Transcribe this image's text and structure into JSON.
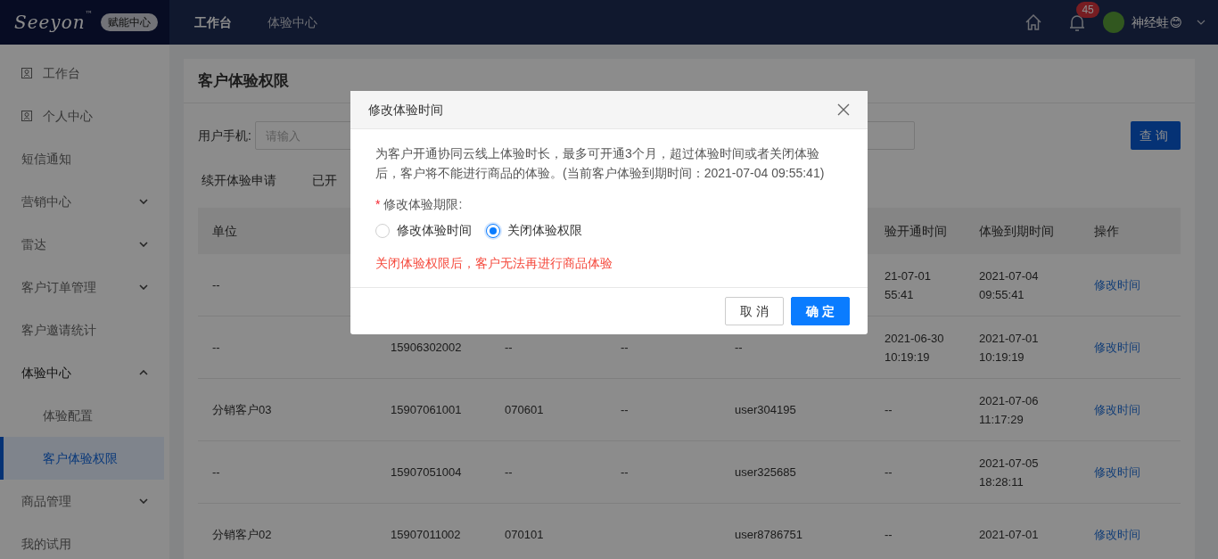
{
  "topbar": {
    "logo": "Seeyon",
    "logo_mark": "™",
    "badge": "赋能中心",
    "nav": [
      {
        "label": "工作台",
        "selected": true
      },
      {
        "label": "体验中心",
        "selected": false
      }
    ],
    "notification_count": "45",
    "user_name": "神经蛙😊"
  },
  "sidebar": {
    "items": [
      {
        "label": "工作台",
        "kind": "icon"
      },
      {
        "label": "个人中心",
        "kind": "icon"
      },
      {
        "label": "短信通知",
        "kind": "plain"
      },
      {
        "label": "营销中心",
        "kind": "group",
        "expanded": false
      },
      {
        "label": "雷达",
        "kind": "group",
        "expanded": false
      },
      {
        "label": "客户订单管理",
        "kind": "group",
        "expanded": false
      },
      {
        "label": "客户邀请统计",
        "kind": "plain"
      },
      {
        "label": "体验中心",
        "kind": "group",
        "expanded": true,
        "children": [
          {
            "label": "体验配置",
            "selected": false
          },
          {
            "label": "客户体验权限",
            "selected": true
          }
        ]
      },
      {
        "label": "商品管理",
        "kind": "group",
        "expanded": false
      },
      {
        "label": "我的试用",
        "kind": "plain"
      }
    ]
  },
  "page": {
    "title": "客户体验权限",
    "filter_label": "用户手机:",
    "filter_placeholder": "请输入",
    "search_button": "查询",
    "tabs": [
      {
        "label": "续开体验申请",
        "selected": false
      },
      {
        "label": "已开",
        "selected": false
      }
    ],
    "table": {
      "columns": [
        "单位",
        null,
        null,
        null,
        null,
        "验开通时间",
        "体验到期时间",
        "操作"
      ],
      "rows": [
        {
          "cells": [
            "--",
            null,
            null,
            null,
            null,
            "21-07-01\n55:41",
            "2021-07-04\n09:55:41"
          ],
          "action": "修改时间"
        },
        {
          "cells": [
            "--",
            "15906302002",
            "--",
            "--",
            "--",
            "2021-06-30\n10:19:19",
            "2021-07-01\n10:19:19"
          ],
          "action": "修改时间"
        },
        {
          "cells": [
            "分销客户03",
            "15907061001",
            "070601",
            "--",
            "user304195",
            "--",
            "2021-07-06\n11:17:29"
          ],
          "action": "修改时间"
        },
        {
          "cells": [
            "--",
            "15907051004",
            "--",
            "--",
            "user325685",
            "--",
            "2021-07-05\n18:28:11"
          ],
          "action": "修改时间"
        },
        {
          "cells": [
            "分销客户02",
            "15907011002",
            "070101",
            null,
            "user8786751",
            "--",
            "2021-07-01"
          ],
          "action": "修改时间"
        }
      ]
    }
  },
  "dialog": {
    "title": "修改体验时间",
    "description": "为客户开通协同云线上体验时长，最多可开通3个月，超过体验时间或者关闭体验后，客户将不能进行商品的体验。(当前客户体验到期时间：2021-07-04 09:55:41)",
    "required_mark": "*",
    "field_label": "修改体验期限:",
    "options": [
      {
        "label": "修改体验时间",
        "selected": false
      },
      {
        "label": "关闭体验权限",
        "selected": true
      }
    ],
    "warning": "关闭体验权限后，客户无法再进行商品体验",
    "buttons": [
      {
        "label": "取消",
        "kind": "secondary"
      },
      {
        "label": "确定",
        "kind": "primary"
      }
    ]
  }
}
